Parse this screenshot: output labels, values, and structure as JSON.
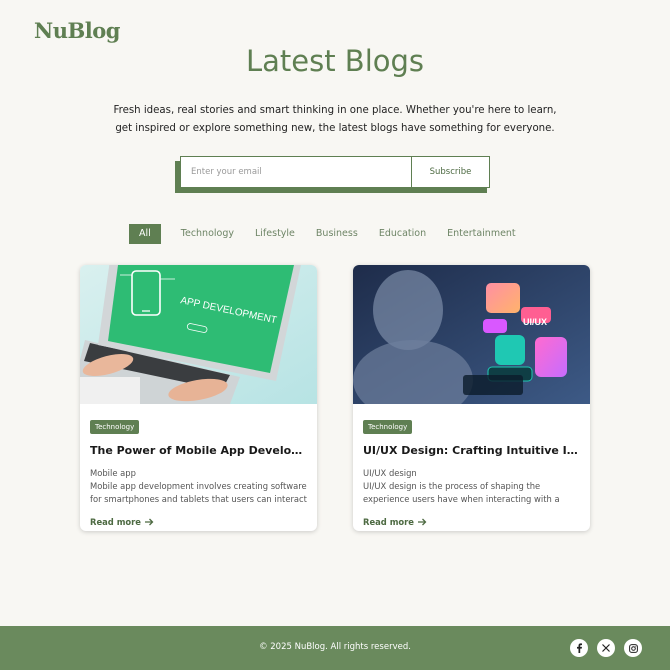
{
  "header": {
    "logo": "NuBlog"
  },
  "hero": {
    "title": "Latest Blogs",
    "description": "Fresh ideas, real stories and smart thinking in one place. Whether you're here to learn, get inspired or explore something new, the latest blogs have something for everyone."
  },
  "subscribe": {
    "placeholder": "Enter your email",
    "value": "",
    "button_label": "Subscribe"
  },
  "filters": [
    "All",
    "Technology",
    "Lifestyle",
    "Business",
    "Education",
    "Entertainment"
  ],
  "active_filter": "All",
  "posts": [
    {
      "badge": "Technology",
      "title": "The Power of Mobile App Development:...",
      "category": "Mobile app",
      "excerpt": "Mobile app development involves creating software for smartphones and tablets that users can interact with to...",
      "read_more": "Read more",
      "image_text": "APP DEVELOPMENT"
    },
    {
      "badge": "Technology",
      "title": "UI/UX Design: Crafting Intuitive Interfac...",
      "category": "UI/UX design",
      "excerpt": "UI/UX design is the process of shaping the experience users have when interacting with a digital product. UI...",
      "read_more": "Read more",
      "image_text": "UI/UX"
    }
  ],
  "footer": {
    "copyright": "© 2025 NuBlog. All rights reserved.",
    "socials": [
      "facebook-icon",
      "x-icon",
      "instagram-icon"
    ]
  },
  "colors": {
    "accent": "#5f7f52",
    "footer": "#6a8a5d",
    "background": "#f8f7f3"
  }
}
